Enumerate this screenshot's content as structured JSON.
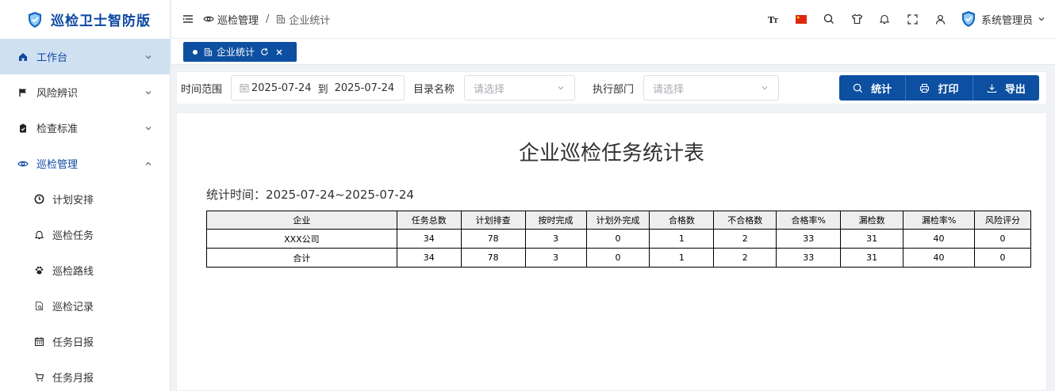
{
  "app": {
    "title": "巡检卫士智防版"
  },
  "sidebar": {
    "items": [
      {
        "label": "工作台",
        "icon": "home-icon",
        "state": "active",
        "chevron": "down"
      },
      {
        "label": "风险辨识",
        "icon": "flag-icon",
        "state": "normal",
        "chevron": "down"
      },
      {
        "label": "检查标准",
        "icon": "clipboard-icon",
        "state": "normal",
        "chevron": "down"
      },
      {
        "label": "巡检管理",
        "icon": "eye-icon",
        "state": "open",
        "chevron": "up"
      }
    ],
    "subitems": [
      {
        "label": "计划安排",
        "icon": "clock-icon"
      },
      {
        "label": "巡检任务",
        "icon": "bell-icon"
      },
      {
        "label": "巡检路线",
        "icon": "paw-icon"
      },
      {
        "label": "巡检记录",
        "icon": "document-search-icon"
      },
      {
        "label": "任务日报",
        "icon": "calendar-icon"
      },
      {
        "label": "任务月报",
        "icon": "cart-icon"
      }
    ]
  },
  "header": {
    "breadcrumb": [
      "巡检管理",
      "企业统计"
    ],
    "breadcrumb_sep": "/",
    "user_name": "系统管理员",
    "icons": [
      "font-size-icon",
      "china-flag-icon",
      "search-icon",
      "theme-shirt-icon",
      "bell-icon",
      "fullscreen-icon",
      "user-icon"
    ]
  },
  "tabs": [
    {
      "label": "企业统计",
      "active": true
    }
  ],
  "filters": {
    "time_range_label": "时间范围",
    "start_date": "2025-07-24",
    "to_label": "到",
    "end_date": "2025-07-24",
    "catalog_label": "目录名称",
    "catalog_placeholder": "请选择",
    "department_label": "执行部门",
    "department_placeholder": "请选择",
    "buttons": {
      "stats": "统计",
      "print": "打印",
      "export": "导出"
    }
  },
  "report": {
    "title": "企业巡检任务统计表",
    "time_text": "统计时间：2025-07-24~2025-07-24",
    "columns": [
      "企业",
      "任务总数",
      "计划排查",
      "按时完成",
      "计划外完成",
      "合格数",
      "不合格数",
      "合格率%",
      "漏检数",
      "漏检率%",
      "风险评分"
    ],
    "rows": [
      [
        "XXX公司",
        "34",
        "78",
        "3",
        "0",
        "1",
        "2",
        "33",
        "31",
        "40",
        "0"
      ],
      [
        "合计",
        "34",
        "78",
        "3",
        "0",
        "1",
        "2",
        "33",
        "31",
        "40",
        "0"
      ]
    ]
  },
  "colors": {
    "brand": "#0d4fa1",
    "active_bg": "#cfe0f1",
    "brand_text": "#0d47a1"
  }
}
